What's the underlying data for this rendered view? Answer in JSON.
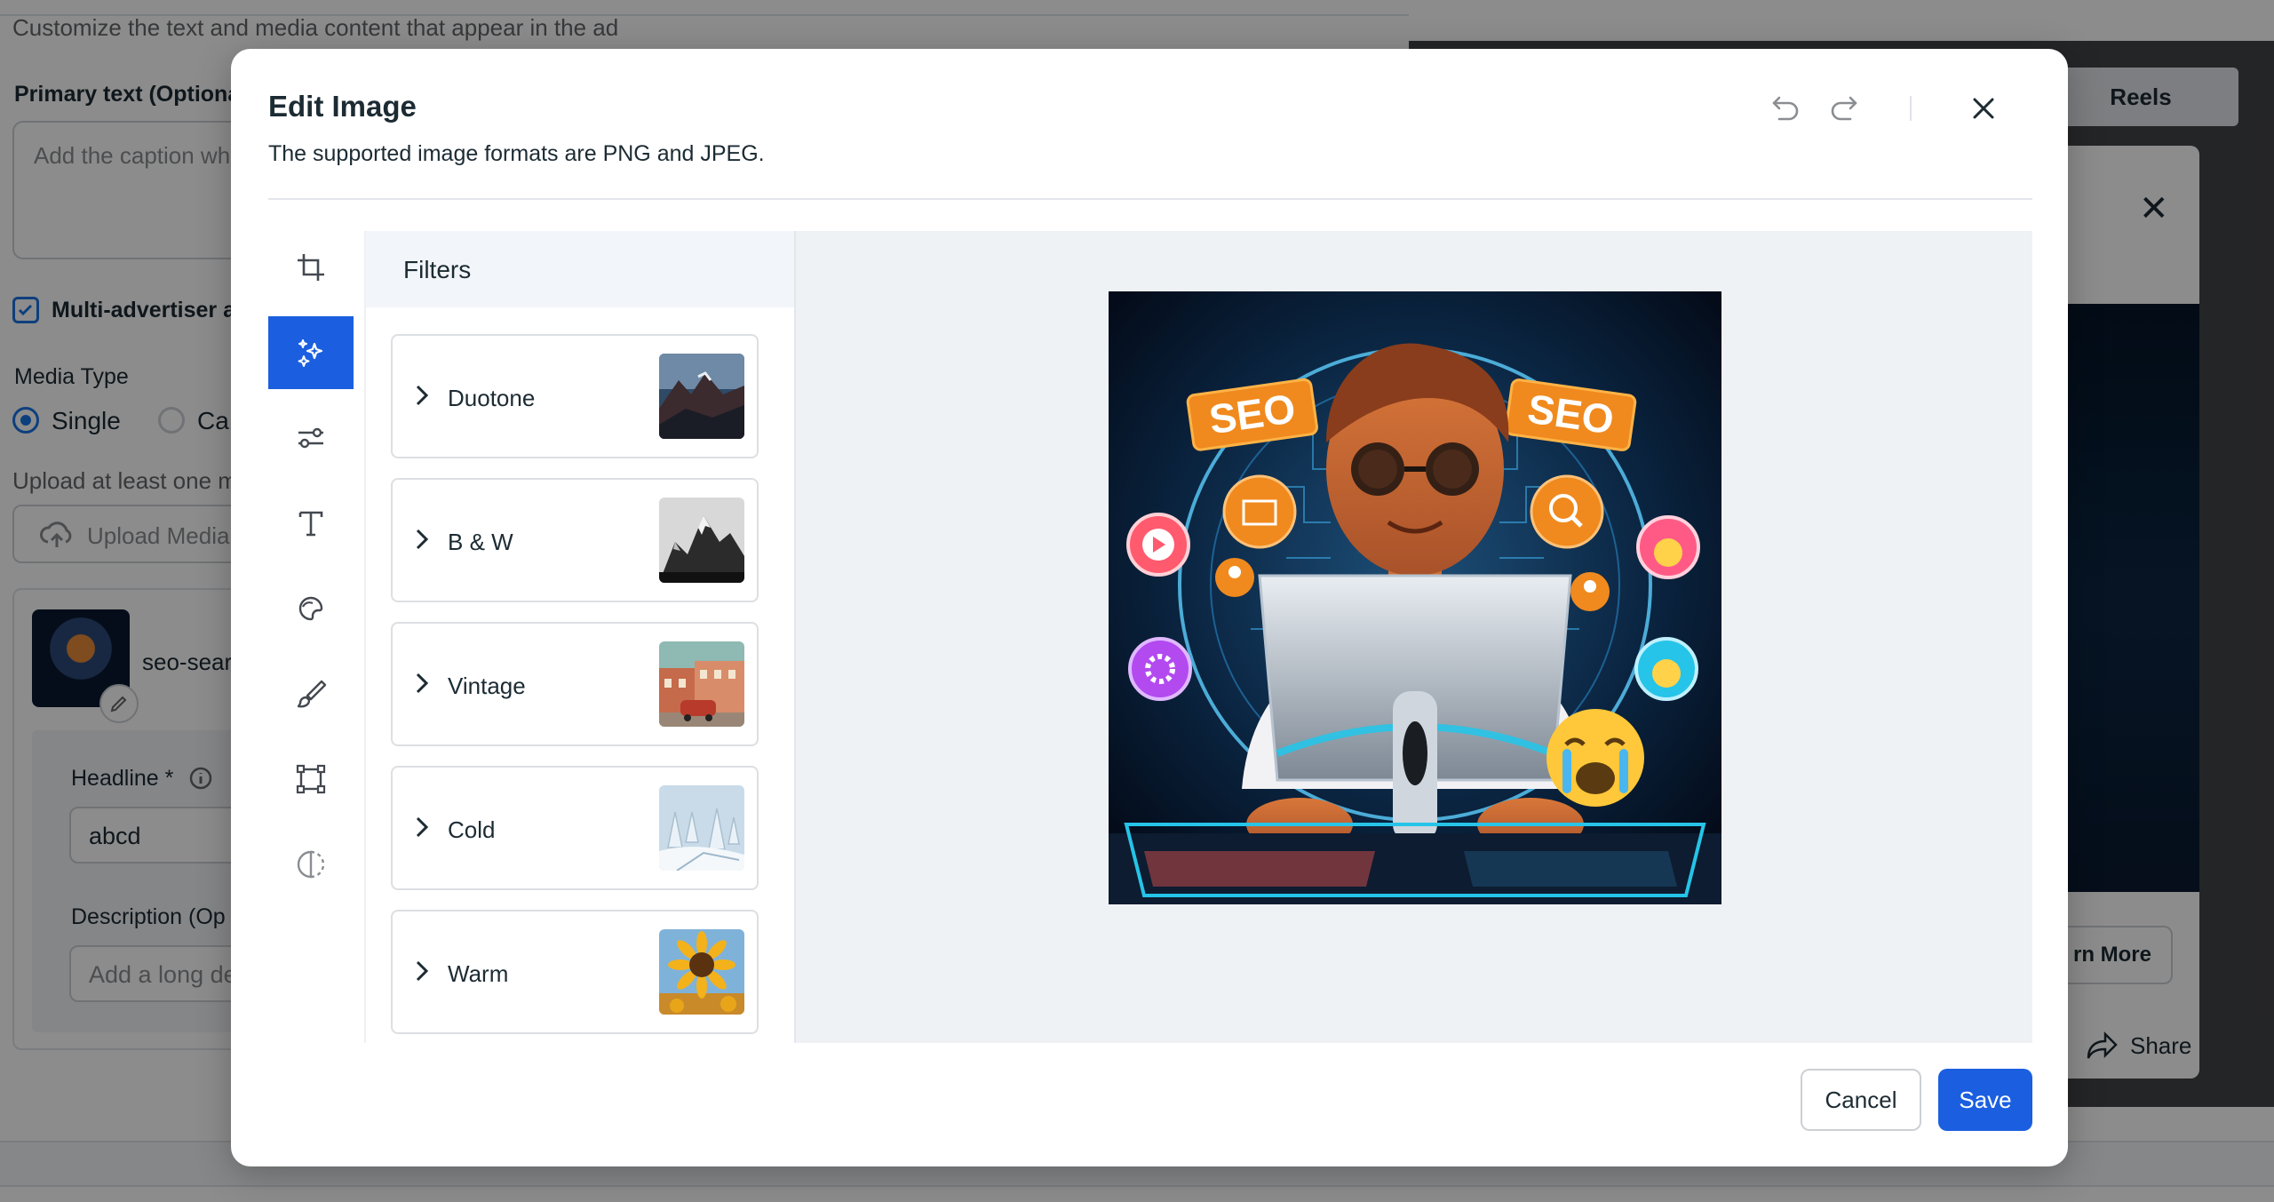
{
  "background": {
    "section_description": "Customize the text and media content that appear in the ad",
    "primary_text_label": "Primary text (Optiona",
    "primary_text_placeholder": "Add the caption wh",
    "multi_advertiser_label": "Multi-advertiser a",
    "media_type_label": "Media Type",
    "media_type_options": [
      "Single",
      "Ca"
    ],
    "upload_hint": "Upload at least one m",
    "upload_button": "Upload Media",
    "media_filename": "seo-sear",
    "headline_label": "Headline *",
    "headline_value": "abcd",
    "description_label": "Description (Op",
    "description_placeholder": "Add a long de",
    "preview_tab": "Reels",
    "preview_cta": "rn More",
    "preview_share": "Share"
  },
  "modal": {
    "title": "Edit Image",
    "subtitle": "The supported image formats are PNG and JPEG.",
    "filters_heading": "Filters",
    "filters": [
      {
        "name": "Duotone",
        "thumb": "mountain-dusk"
      },
      {
        "name": "B & W",
        "thumb": "mountain-mono"
      },
      {
        "name": "Vintage",
        "thumb": "town-car"
      },
      {
        "name": "Cold",
        "thumb": "snowy-trees"
      },
      {
        "name": "Warm",
        "thumb": "sunflower"
      }
    ],
    "tools": [
      "crop-icon",
      "filters-icon",
      "adjust-icon",
      "text-icon",
      "sticker-icon",
      "brush-icon",
      "frame-icon",
      "contrast-icon"
    ],
    "active_tool": "filters-icon",
    "image_labels": [
      "SEO",
      "SEO"
    ],
    "cancel_label": "Cancel",
    "save_label": "Save",
    "accent": "#1b5fe0"
  }
}
